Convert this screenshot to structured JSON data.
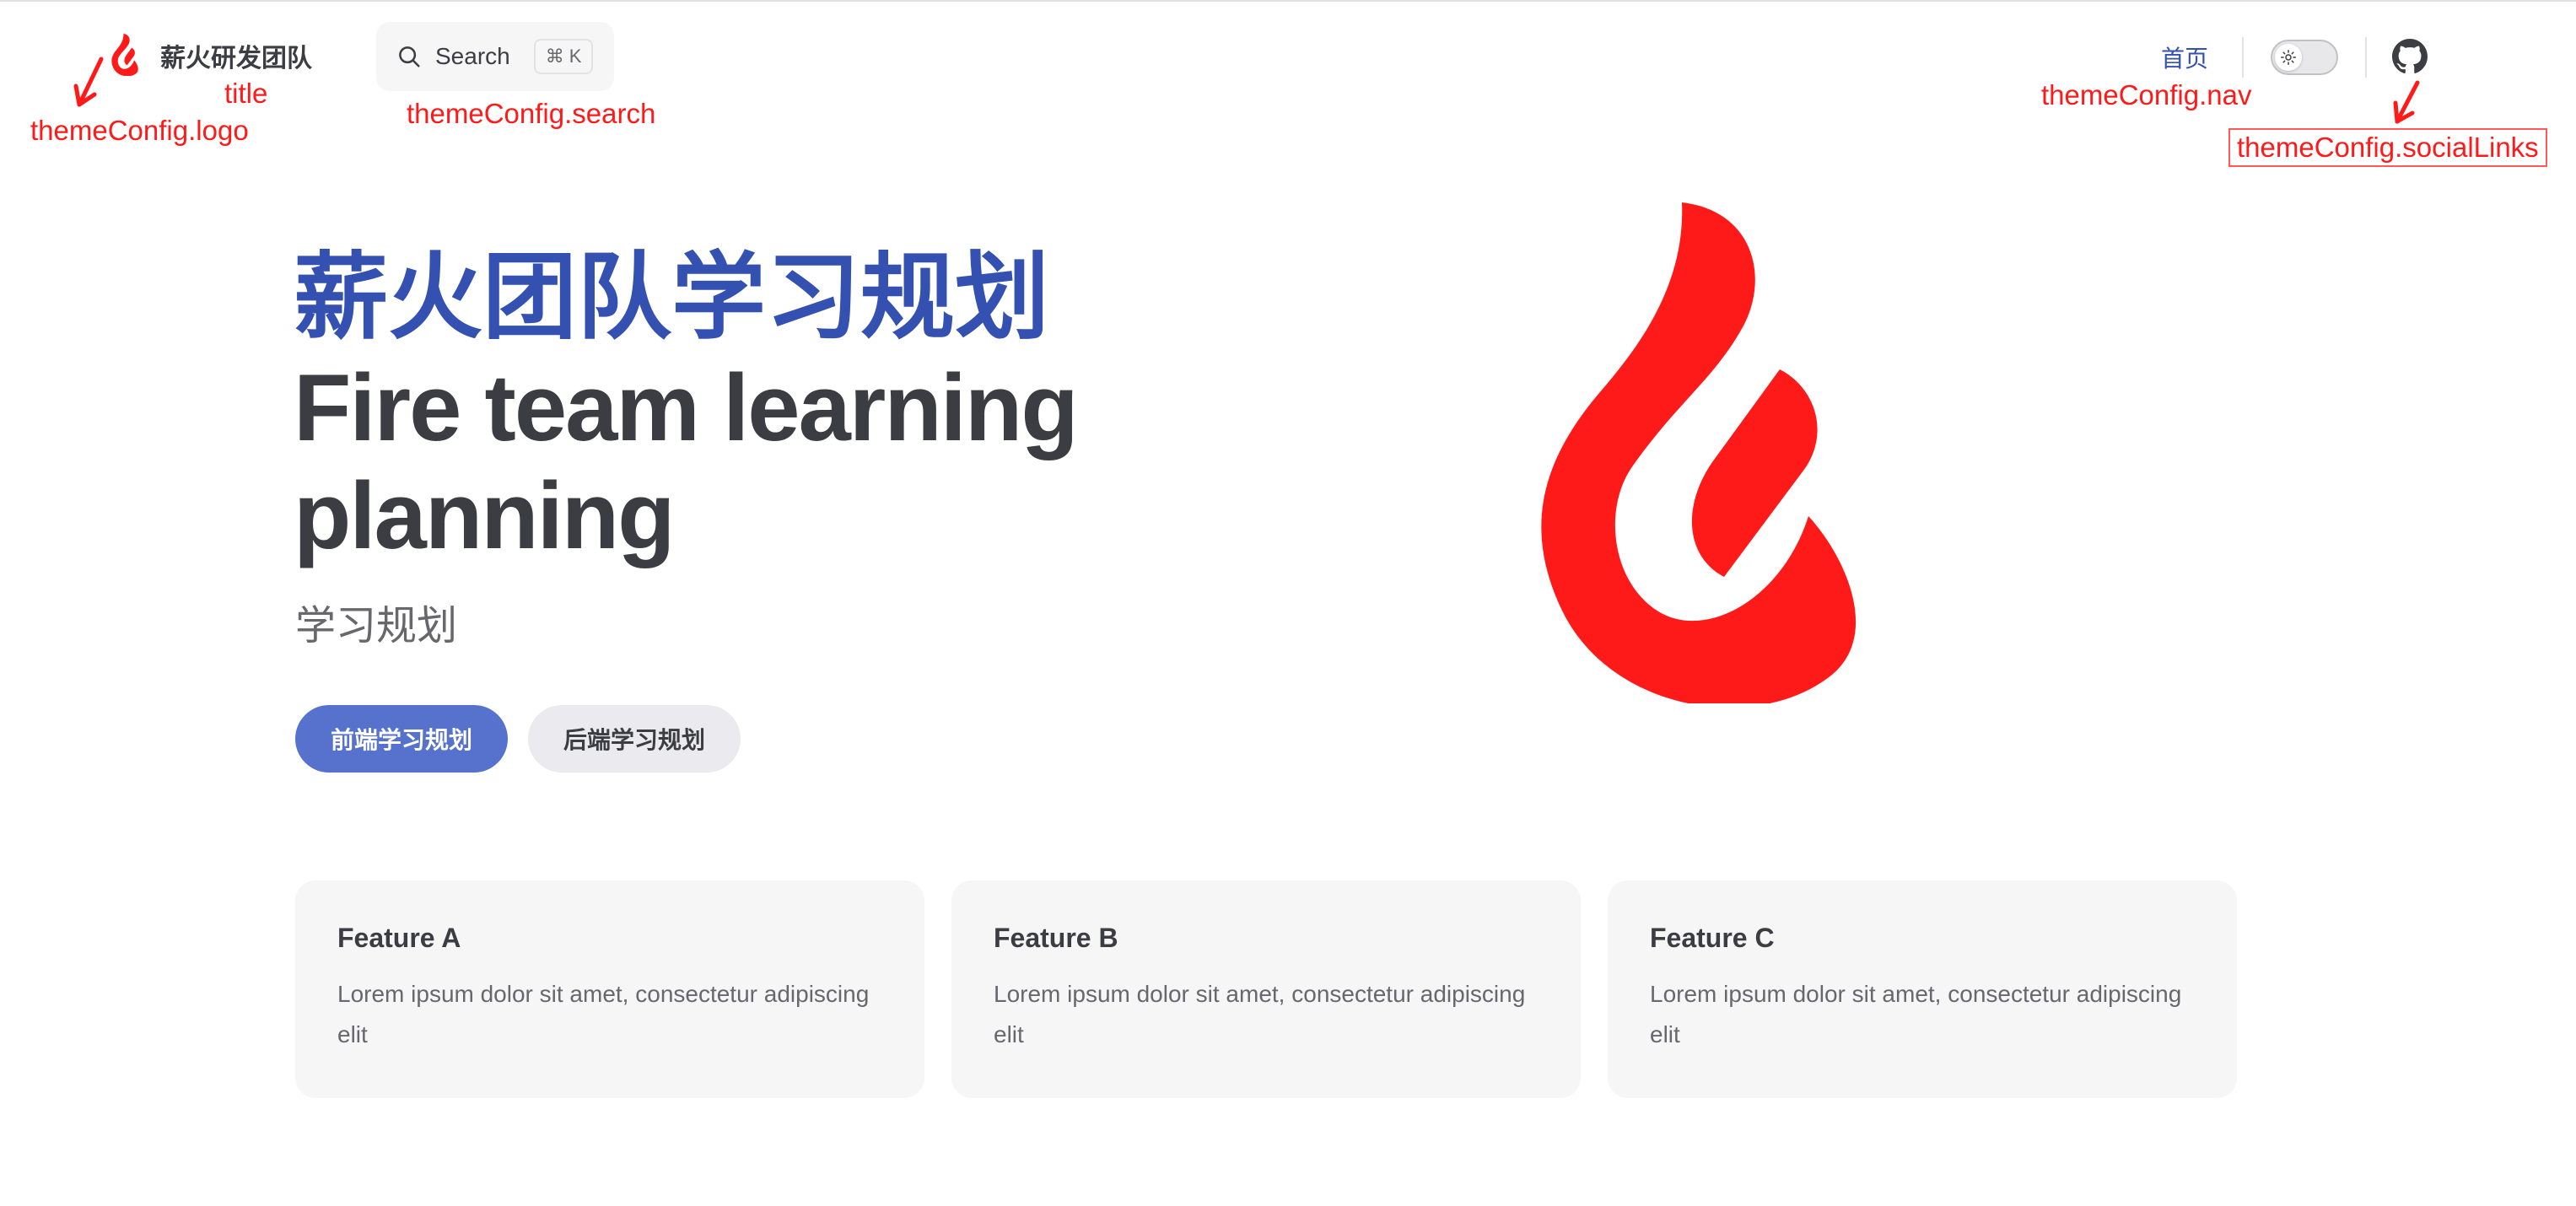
{
  "nav": {
    "title": "薪火研发团队",
    "search": {
      "label": "Search",
      "kbd_meta": "⌘",
      "kbd_key": "K"
    },
    "links": [
      {
        "label": "首页"
      }
    ],
    "social": [
      {
        "icon": "github-icon"
      }
    ]
  },
  "annotations": {
    "logo": "themeConfig.logo",
    "title": "title",
    "search": "themeConfig.search",
    "nav": "themeConfig.nav",
    "social": "themeConfig.socialLinks"
  },
  "hero": {
    "name": "薪火团队学习规划",
    "text": "Fire team learning planning",
    "tagline": "学习规划",
    "actions": [
      {
        "label": "前端学习规划",
        "theme": "brand"
      },
      {
        "label": "后端学习规划",
        "theme": "alt"
      }
    ]
  },
  "features": [
    {
      "title": "Feature A",
      "details": "Lorem ipsum dolor sit amet, consectetur adipiscing elit"
    },
    {
      "title": "Feature B",
      "details": "Lorem ipsum dolor sit amet, consectetur adipiscing elit"
    },
    {
      "title": "Feature C",
      "details": "Lorem ipsum dolor sit amet, consectetur adipiscing elit"
    }
  ],
  "colors": {
    "brand": "#3451b2",
    "brand_button": "#5672cd",
    "logo_red": "#ff1a1a",
    "annotation_red": "#ff1a1a",
    "text": "#3c3c43",
    "muted": "#67676c",
    "card_bg": "#f6f6f7"
  }
}
